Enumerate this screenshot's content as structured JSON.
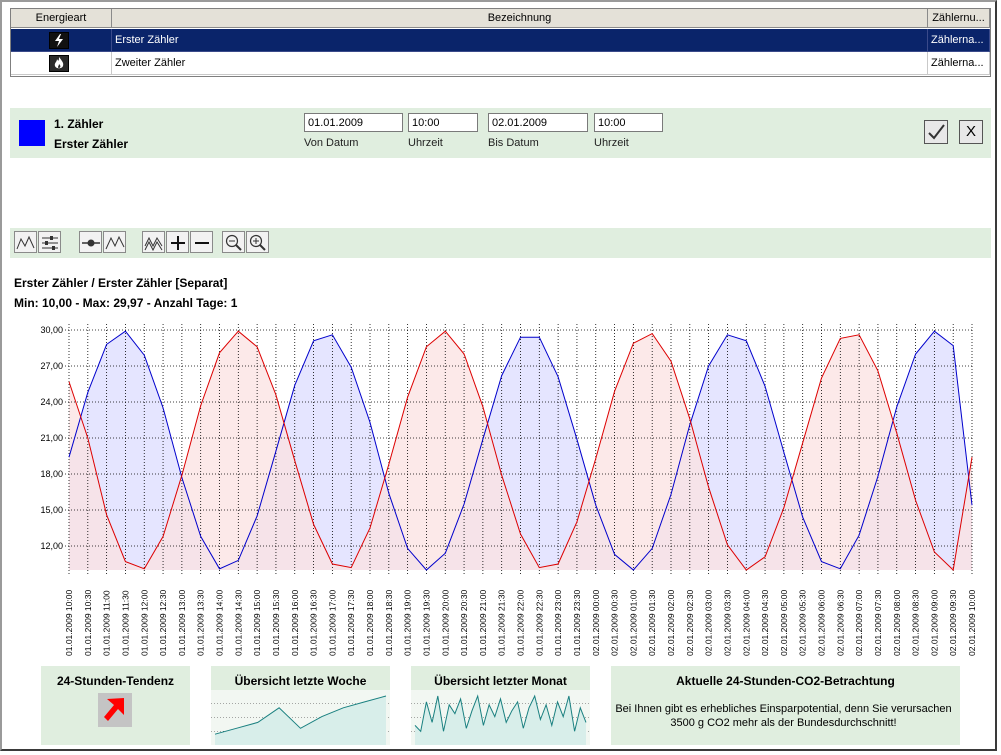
{
  "grid": {
    "columns": [
      "Energieart",
      "Bezeichnung",
      "Zählernu..."
    ],
    "rows": [
      {
        "energy_icon": "lightning-icon",
        "name": "Erster Zähler",
        "number": "Zählerna..."
      },
      {
        "energy_icon": "flame-icon",
        "name": "Zweiter Zähler",
        "number": "Zählerna..."
      }
    ]
  },
  "meter": {
    "color": "#0000ff",
    "title": "1. Zähler",
    "name": "Erster Zähler"
  },
  "dates": {
    "from_date": "01.01.2009",
    "from_time": "10:00",
    "to_date": "02.01.2009",
    "to_time": "10:00",
    "from_date_label": "Von Datum",
    "from_time_label": "Uhrzeit",
    "to_date_label": "Bis Datum",
    "to_time_label": "Uhrzeit",
    "ok_icon": "checkmark-icon",
    "cancel_label": "X"
  },
  "toolbar": {
    "icons": [
      "line-chart-icon",
      "legend-lines-icon",
      "data-point-icon",
      "curve-icon",
      "multi-line-icon",
      "plus-icon",
      "minus-icon",
      "zoom-out-icon",
      "zoom-in-icon"
    ]
  },
  "chart": {
    "title": "Erster Zähler / Erster Zähler [Separat]",
    "stats": "Min: 10,00 - Max: 29,97 - Anzahl Tage: 1"
  },
  "chart_data": {
    "type": "area",
    "ylim": [
      10,
      30
    ],
    "yticks": [
      "12,00",
      "15,00",
      "18,00",
      "21,00",
      "24,00",
      "27,00",
      "30,00"
    ],
    "ytick_values": [
      12,
      15,
      18,
      21,
      24,
      27,
      30
    ],
    "categories": [
      "01.01.2009 10:00",
      "01.01.2009 10:30",
      "01.01.2009 11:00",
      "01.01.2009 11:30",
      "01.01.2009 12:00",
      "01.01.2009 12:30",
      "01.01.2009 13:00",
      "01.01.2009 13:30",
      "01.01.2009 14:00",
      "01.01.2009 14:30",
      "01.01.2009 15:00",
      "01.01.2009 15:30",
      "01.01.2009 16:00",
      "01.01.2009 16:30",
      "01.01.2009 17:00",
      "01.01.2009 17:30",
      "01.01.2009 18:00",
      "01.01.2009 18:30",
      "01.01.2009 19:00",
      "01.01.2009 19:30",
      "01.01.2009 20:00",
      "01.01.2009 20:30",
      "01.01.2009 21:00",
      "01.01.2009 21:30",
      "01.01.2009 22:00",
      "01.01.2009 22:30",
      "01.01.2009 23:00",
      "01.01.2009 23:30",
      "02.01.2009 00:00",
      "02.01.2009 00:30",
      "02.01.2009 01:00",
      "02.01.2009 01:30",
      "02.01.2009 02:00",
      "02.01.2009 02:30",
      "02.01.2009 03:00",
      "02.01.2009 03:30",
      "02.01.2009 04:00",
      "02.01.2009 04:30",
      "02.01.2009 05:00",
      "02.01.2009 05:30",
      "02.01.2009 06:00",
      "02.01.2009 06:30",
      "02.01.2009 07:00",
      "02.01.2009 07:30",
      "02.01.2009 08:00",
      "02.01.2009 08:30",
      "02.01.2009 09:00",
      "02.01.2009 09:30",
      "02.01.2009 10:00"
    ],
    "series": [
      {
        "color": "#0000cc",
        "fill": "#dcdcff",
        "values": [
          19.4,
          24.8,
          28.8,
          29.9,
          27.9,
          23.5,
          17.7,
          12.8,
          10.1,
          10.8,
          14.5,
          19.9,
          25.4,
          29.1,
          29.6,
          26.9,
          22.3,
          16.4,
          11.8,
          10.0,
          11.4,
          15.5,
          20.9,
          26.2,
          29.4,
          29.4,
          26.1,
          20.9,
          15.4,
          11.3,
          10.0,
          11.8,
          16.3,
          22.1,
          27.0,
          29.6,
          29.1,
          25.3,
          19.8,
          14.4,
          10.7,
          10.1,
          12.9,
          17.8,
          23.6,
          28.0,
          29.9,
          28.7,
          15.4
        ]
      },
      {
        "color": "#dd0000",
        "fill": "#fbe2e2",
        "values": [
          25.7,
          21.0,
          14.6,
          10.7,
          10.1,
          12.8,
          17.9,
          23.7,
          28.1,
          29.9,
          28.6,
          24.6,
          19.1,
          13.8,
          10.5,
          10.2,
          13.5,
          18.8,
          24.4,
          28.6,
          29.9,
          28.0,
          23.6,
          17.9,
          13.0,
          10.2,
          10.5,
          14.0,
          19.3,
          24.9,
          28.9,
          29.7,
          27.4,
          22.6,
          16.9,
          12.1,
          10.0,
          11.1,
          15.2,
          20.6,
          26.0,
          29.3,
          29.6,
          26.6,
          21.4,
          15.8,
          11.5,
          10.0,
          19.4
        ]
      }
    ]
  },
  "panels": [
    {
      "title": "24-Stunden-Tendenz",
      "icon": "trend-arrow-up-icon"
    },
    {
      "title": "Übersicht letzte Woche",
      "values": [
        3,
        5,
        7,
        12,
        5,
        9,
        12,
        14,
        16
      ]
    },
    {
      "title": "Übersicht letzter Monat",
      "values": [
        6,
        4,
        14,
        7,
        16,
        4,
        13,
        10,
        15,
        5,
        11,
        16,
        6,
        13,
        9,
        15,
        7,
        11,
        14,
        5,
        12,
        16,
        8,
        13,
        6,
        14,
        9,
        16,
        4,
        12,
        7
      ]
    },
    {
      "title": "Aktuelle 24-Stunden-CO2-Betrachtung",
      "text": "Bei Ihnen gibt es erhebliches Einsparpotential, denn Sie verursachen 3500 g CO2 mehr als der Bundesdurchschnitt!"
    }
  ]
}
